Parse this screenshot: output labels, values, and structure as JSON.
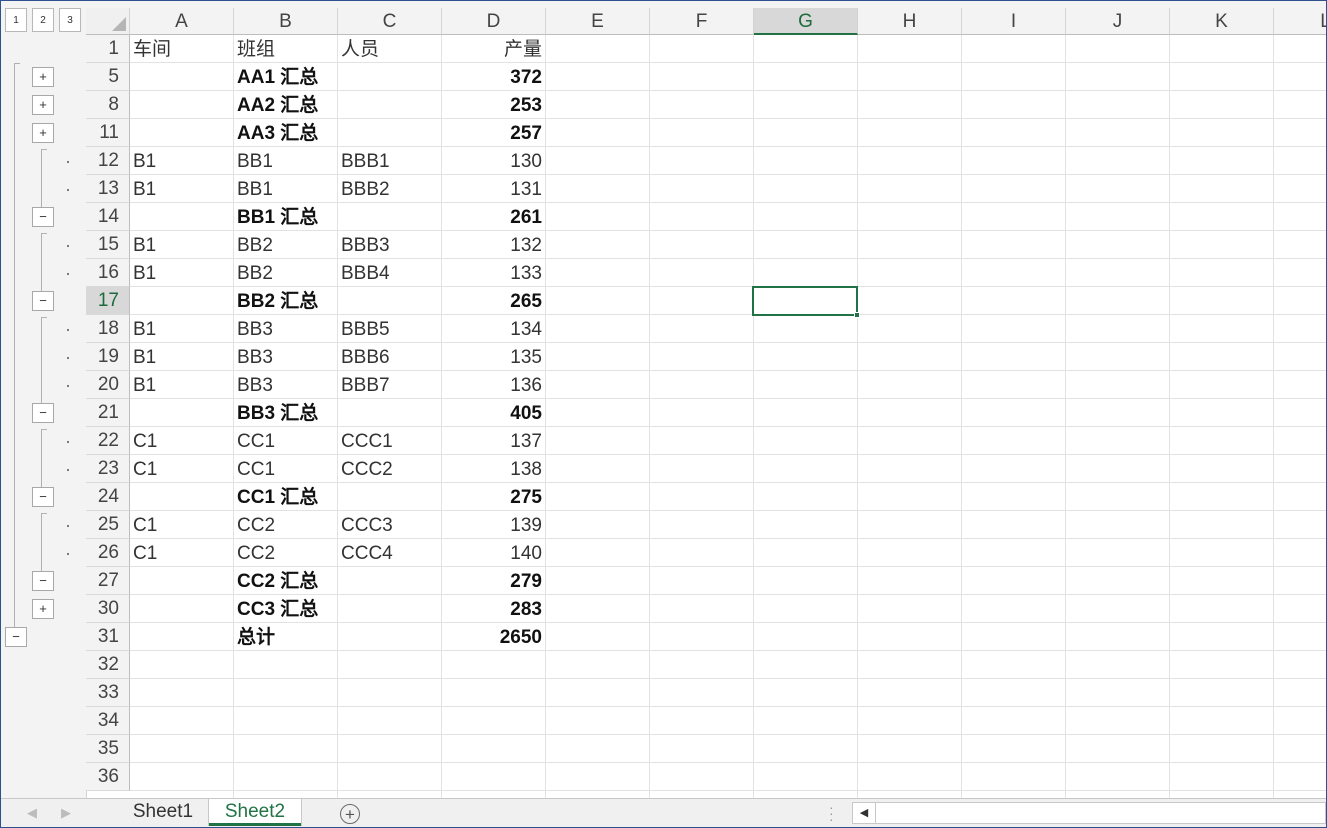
{
  "columns": [
    "A",
    "B",
    "C",
    "D",
    "E",
    "F",
    "G",
    "H",
    "I",
    "J",
    "K",
    "L"
  ],
  "selected_column": "G",
  "selected_row": "17",
  "outline_levels": [
    "1",
    "2",
    "3"
  ],
  "rows": [
    {
      "num": "1",
      "a": "车间",
      "b": "班组",
      "c": "人员",
      "d": "产量",
      "bold": false
    },
    {
      "num": "5",
      "a": "",
      "b": "AA1 汇总",
      "c": "",
      "d": "372",
      "bold": true
    },
    {
      "num": "8",
      "a": "",
      "b": "AA2 汇总",
      "c": "",
      "d": "253",
      "bold": true
    },
    {
      "num": "11",
      "a": "",
      "b": "AA3 汇总",
      "c": "",
      "d": "257",
      "bold": true
    },
    {
      "num": "12",
      "a": "B1",
      "b": "BB1",
      "c": "BBB1",
      "d": "130",
      "bold": false
    },
    {
      "num": "13",
      "a": "B1",
      "b": "BB1",
      "c": "BBB2",
      "d": "131",
      "bold": false
    },
    {
      "num": "14",
      "a": "",
      "b": "BB1 汇总",
      "c": "",
      "d": "261",
      "bold": true
    },
    {
      "num": "15",
      "a": "B1",
      "b": "BB2",
      "c": "BBB3",
      "d": "132",
      "bold": false
    },
    {
      "num": "16",
      "a": "B1",
      "b": "BB2",
      "c": "BBB4",
      "d": "133",
      "bold": false
    },
    {
      "num": "17",
      "a": "",
      "b": "BB2 汇总",
      "c": "",
      "d": "265",
      "bold": true
    },
    {
      "num": "18",
      "a": "B1",
      "b": "BB3",
      "c": "BBB5",
      "d": "134",
      "bold": false
    },
    {
      "num": "19",
      "a": "B1",
      "b": "BB3",
      "c": "BBB6",
      "d": "135",
      "bold": false
    },
    {
      "num": "20",
      "a": "B1",
      "b": "BB3",
      "c": "BBB7",
      "d": "136",
      "bold": false
    },
    {
      "num": "21",
      "a": "",
      "b": "BB3 汇总",
      "c": "",
      "d": "405",
      "bold": true
    },
    {
      "num": "22",
      "a": "C1",
      "b": "CC1",
      "c": "CCC1",
      "d": "137",
      "bold": false
    },
    {
      "num": "23",
      "a": "C1",
      "b": "CC1",
      "c": "CCC2",
      "d": "138",
      "bold": false
    },
    {
      "num": "24",
      "a": "",
      "b": "CC1 汇总",
      "c": "",
      "d": "275",
      "bold": true
    },
    {
      "num": "25",
      "a": "C1",
      "b": "CC2",
      "c": "CCC3",
      "d": "139",
      "bold": false
    },
    {
      "num": "26",
      "a": "C1",
      "b": "CC2",
      "c": "CCC4",
      "d": "140",
      "bold": false
    },
    {
      "num": "27",
      "a": "",
      "b": "CC2 汇总",
      "c": "",
      "d": "279",
      "bold": true
    },
    {
      "num": "30",
      "a": "",
      "b": "CC3 汇总",
      "c": "",
      "d": "283",
      "bold": true
    },
    {
      "num": "31",
      "a": "",
      "b": "总计",
      "c": "",
      "d": "2650",
      "bold": true
    },
    {
      "num": "32",
      "a": "",
      "b": "",
      "c": "",
      "d": "",
      "bold": false
    },
    {
      "num": "33",
      "a": "",
      "b": "",
      "c": "",
      "d": "",
      "bold": false
    },
    {
      "num": "34",
      "a": "",
      "b": "",
      "c": "",
      "d": "",
      "bold": false
    },
    {
      "num": "35",
      "a": "",
      "b": "",
      "c": "",
      "d": "",
      "bold": false
    },
    {
      "num": "36",
      "a": "",
      "b": "",
      "c": "",
      "d": "",
      "bold": false
    }
  ],
  "outline_buttons": [
    {
      "row": "5",
      "symbol": "+"
    },
    {
      "row": "8",
      "symbol": "+"
    },
    {
      "row": "11",
      "symbol": "+"
    },
    {
      "row": "14",
      "symbol": "−"
    },
    {
      "row": "17",
      "symbol": "−"
    },
    {
      "row": "21",
      "symbol": "−"
    },
    {
      "row": "24",
      "symbol": "−"
    },
    {
      "row": "27",
      "symbol": "−"
    },
    {
      "row": "30",
      "symbol": "+"
    },
    {
      "row": "31",
      "symbol": "−"
    }
  ],
  "sheet_tabs": [
    {
      "label": "Sheet1",
      "active": false
    },
    {
      "label": "Sheet2",
      "active": true
    }
  ],
  "add_sheet_label": "+",
  "theme": {
    "accent": "#217346",
    "header_bg": "#f3f3f3",
    "gridline": "#e2e2e2"
  }
}
